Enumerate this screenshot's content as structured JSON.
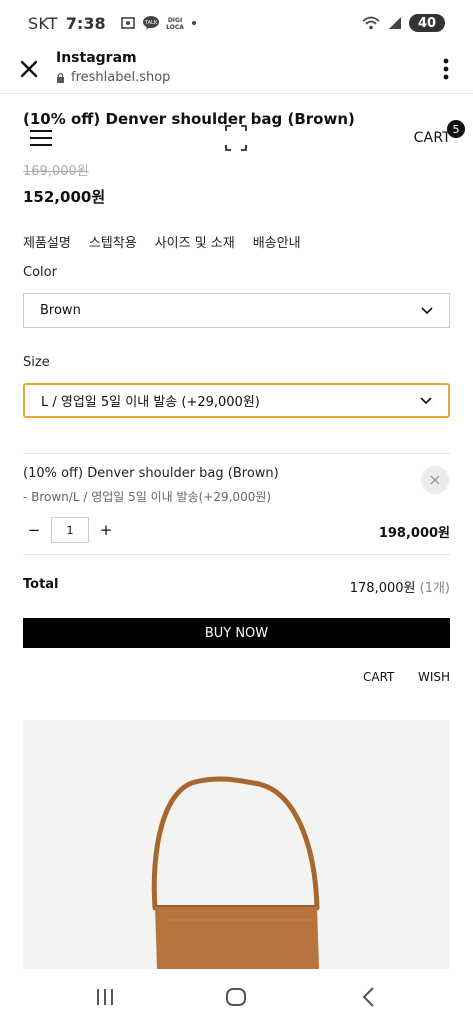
{
  "status_bar": {
    "carrier": "SKT",
    "time": "7:38",
    "battery": "40",
    "icons": [
      "screenshot-icon",
      "talk-icon",
      "digi-loca-icon",
      "dot-icon",
      "wifi-icon",
      "signal-icon",
      "battery-icon"
    ]
  },
  "browser": {
    "title": "Instagram",
    "url": "freshlabel.shop"
  },
  "header": {
    "product_title": "(10% off) Denver shoulder bag (Brown)",
    "cart_label": "CART",
    "cart_count": "5"
  },
  "price": {
    "original": "169,000원",
    "sale": "152,000원"
  },
  "tabs": [
    "제품설명",
    "스텝착용",
    "사이즈 및 소재",
    "배송안내"
  ],
  "options": {
    "color_label": "Color",
    "color_value": "Brown",
    "size_label": "Size",
    "size_value": "L / 영업일 5일 이내 발송 (+29,000원)"
  },
  "selected_item": {
    "name": "(10% off) Denver shoulder bag (Brown)",
    "option": "- Brown/L / 영업일 5일 이내 발송(+29,000원)",
    "minus": "−",
    "quantity": "1",
    "plus": "+",
    "price": "198,000원"
  },
  "total": {
    "label": "Total",
    "value": "178,000원",
    "count": "(1개)"
  },
  "actions": {
    "buy_now": "BUY NOW",
    "cart": "CART",
    "wish": "WISH"
  },
  "colors": {
    "accent_border": "#e4a937",
    "bag_brown": "#b8743e",
    "button_black": "#000000"
  }
}
